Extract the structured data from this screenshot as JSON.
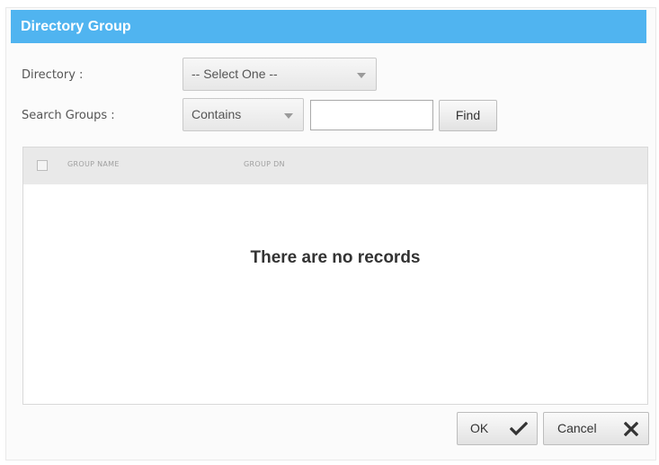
{
  "dialog": {
    "title": "Directory Group"
  },
  "form": {
    "directory_label": "Directory :",
    "directory_value": "-- Select One --",
    "search_label": "Search Groups :",
    "match_mode_value": "Contains",
    "search_value": "",
    "find_label": "Find"
  },
  "grid": {
    "columns": [
      "GROUP NAME",
      "GROUP DN"
    ],
    "empty_message": "There are no records"
  },
  "footer": {
    "ok_label": "OK",
    "cancel_label": "Cancel"
  },
  "icons": {
    "ok": "checkmark-icon",
    "cancel": "x-close-icon",
    "dropdown": "triangle-down-icon"
  },
  "colors": {
    "title_bar": "#50b4f0"
  }
}
